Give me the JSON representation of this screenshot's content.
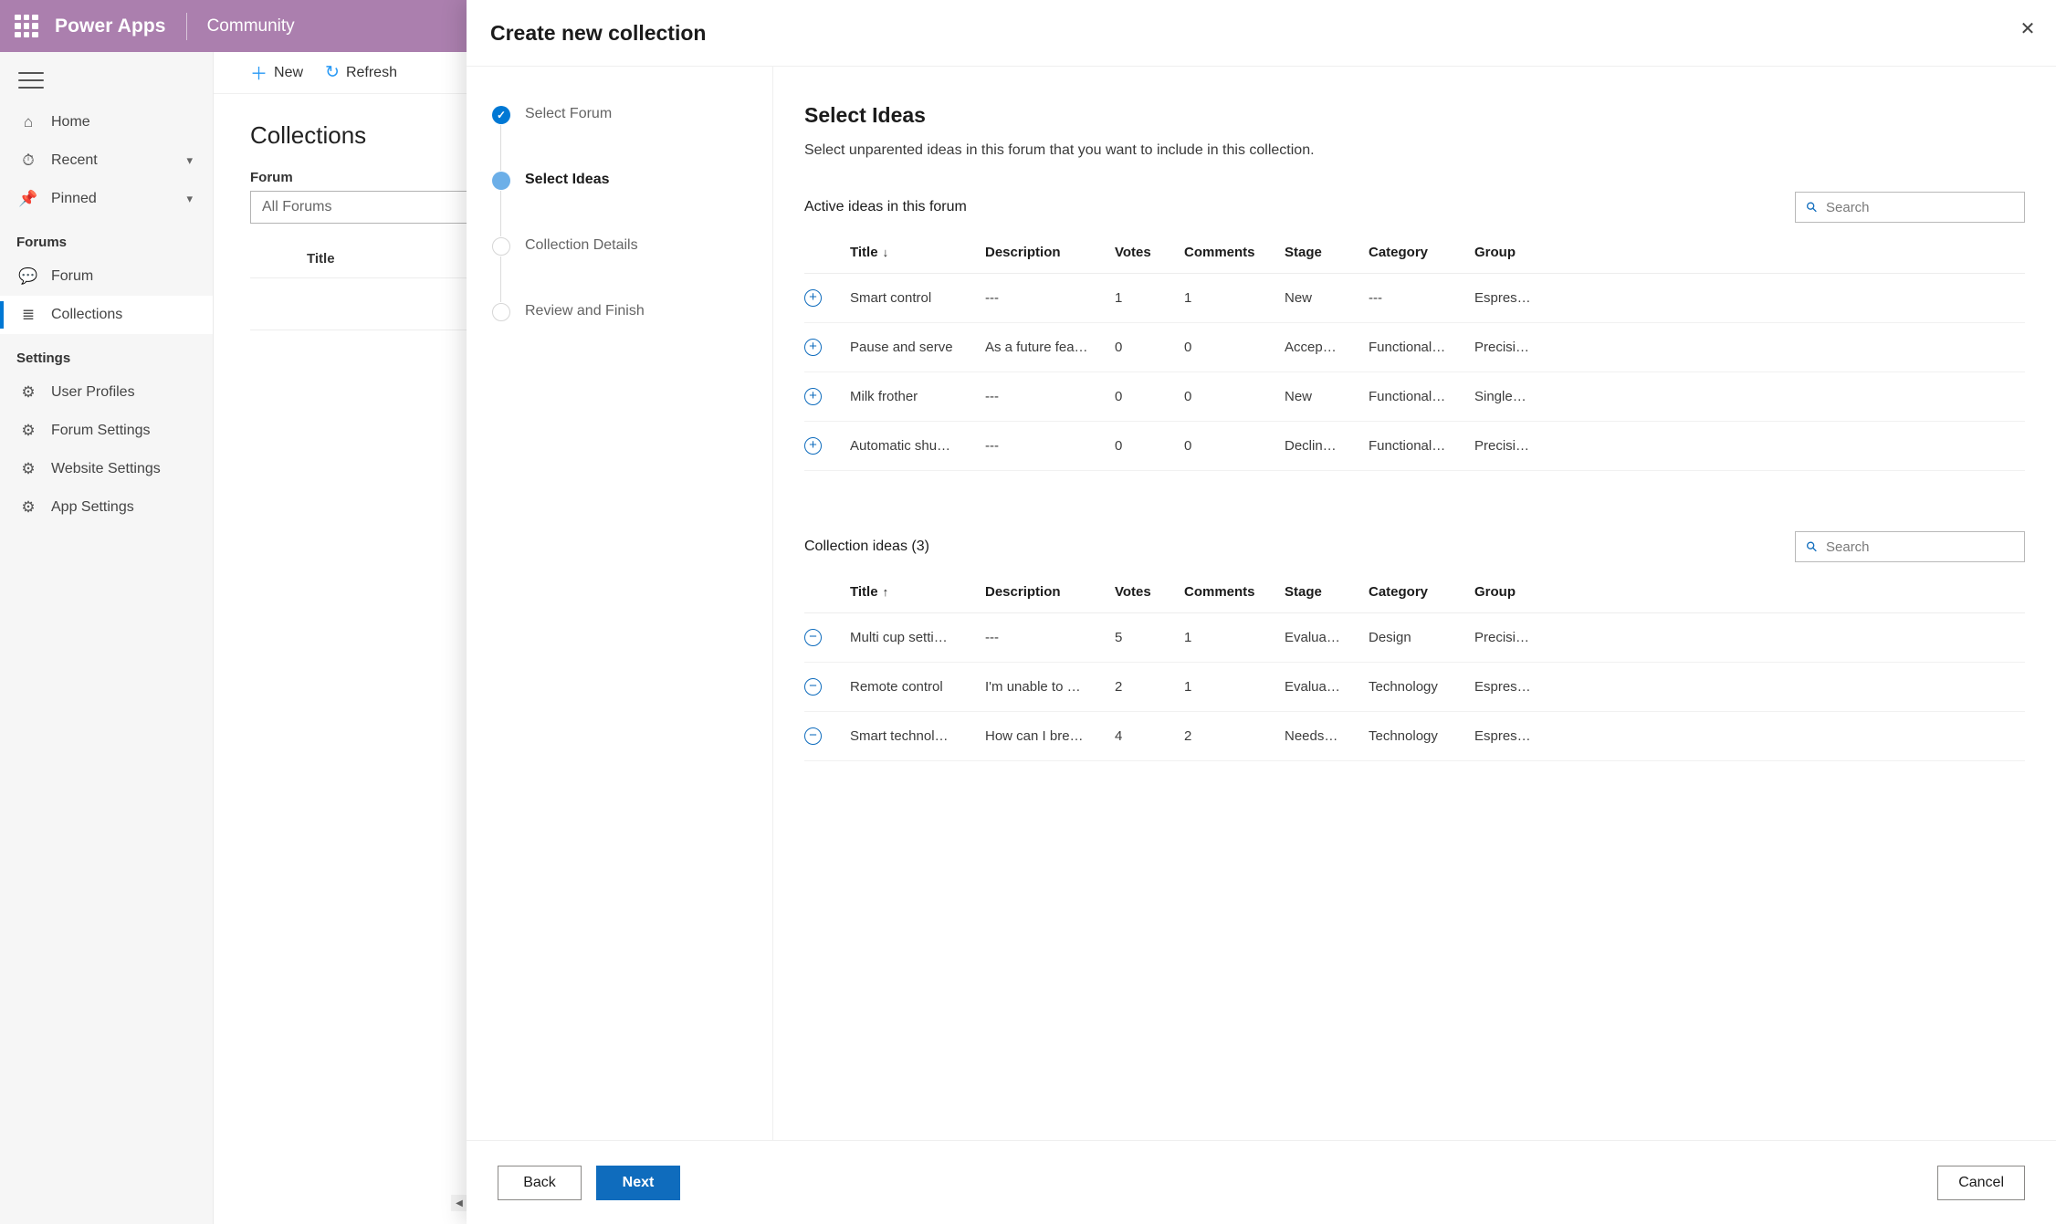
{
  "topbar": {
    "waffle_icon": "app-launcher-icon",
    "brand": "Power Apps",
    "sub_brand": "Community"
  },
  "sidebar": {
    "menu_icon": "hamburger-icon",
    "items": [
      {
        "label": "Home",
        "icon": "home-icon",
        "glyph": "⌂",
        "chevron": "",
        "selected": false
      },
      {
        "label": "Recent",
        "icon": "clock-icon",
        "glyph": "◴",
        "chevron": "⌄",
        "selected": false
      },
      {
        "label": "Pinned",
        "icon": "pin-icon",
        "glyph": "✐",
        "chevron": "⌄",
        "selected": false
      }
    ],
    "groups": [
      {
        "title": "Forums",
        "items": [
          {
            "label": "Forum",
            "icon": "forum-icon",
            "glyph": "⌸",
            "selected": false
          },
          {
            "label": "Collections",
            "icon": "collections-icon",
            "glyph": "≡",
            "selected": true
          }
        ]
      },
      {
        "title": "Settings",
        "items": [
          {
            "label": "User Profiles",
            "icon": "gear-icon",
            "glyph": "⚙",
            "selected": false
          },
          {
            "label": "Forum Settings",
            "icon": "gear-icon",
            "glyph": "⚙",
            "selected": false
          },
          {
            "label": "Website Settings",
            "icon": "gear-icon",
            "glyph": "⚙",
            "selected": false
          },
          {
            "label": "App Settings",
            "icon": "gear-icon",
            "glyph": "⚙",
            "selected": false
          }
        ]
      }
    ]
  },
  "background_page": {
    "commands": [
      {
        "label": "New",
        "icon": "plus-icon",
        "glyph": "＋"
      },
      {
        "label": "Refresh",
        "icon": "refresh-icon",
        "glyph": "↻"
      }
    ],
    "title": "Collections",
    "forum_field_label": "Forum",
    "forum_value": "All Forums",
    "table_header_title": "Title",
    "scrollbar_arrow": "◀"
  },
  "dialog": {
    "title": "Create new collection",
    "close_icon": "close-icon",
    "close_glyph": "✕",
    "steps": [
      {
        "label": "Select Forum",
        "state": "done"
      },
      {
        "label": "Select Ideas",
        "state": "current"
      },
      {
        "label": "Collection Details",
        "state": "todo"
      },
      {
        "label": "Review and Finish",
        "state": "todo"
      }
    ],
    "panel": {
      "heading": "Select Ideas",
      "subtitle": "Select unparented ideas in this forum that you want to include in this collection.",
      "sections": [
        {
          "title": "Active ideas in this forum",
          "search_placeholder": "Search",
          "search_value": "",
          "sort_column": "Title",
          "sort_direction": "↓",
          "action_glyph": "+",
          "action_name": "add-idea-button",
          "columns": [
            "Title",
            "Description",
            "Votes",
            "Comments",
            "Stage",
            "Category",
            "Group"
          ],
          "rows": [
            {
              "title": "Smart control",
              "description": "---",
              "votes": "1",
              "comments": "1",
              "stage": "New",
              "category": "---",
              "group": "Espres…"
            },
            {
              "title": "Pause and serve",
              "description": "As a future fea…",
              "votes": "0",
              "comments": "0",
              "stage": "Accep…",
              "category": "Functional…",
              "group": "Precisi…"
            },
            {
              "title": "Milk frother",
              "description": "---",
              "votes": "0",
              "comments": "0",
              "stage": "New",
              "category": "Functional…",
              "group": "Single…"
            },
            {
              "title": "Automatic shu…",
              "description": "---",
              "votes": "0",
              "comments": "0",
              "stage": "Declin…",
              "category": "Functional…",
              "group": "Precisi…"
            }
          ]
        },
        {
          "title": "Collection ideas (3)",
          "search_placeholder": "Search",
          "search_value": "",
          "sort_column": "Title",
          "sort_direction": "↑",
          "action_glyph": "−",
          "action_name": "remove-idea-button",
          "columns": [
            "Title",
            "Description",
            "Votes",
            "Comments",
            "Stage",
            "Category",
            "Group"
          ],
          "rows": [
            {
              "title": "Multi cup setti…",
              "description": "---",
              "votes": "5",
              "comments": "1",
              "stage": "Evalua…",
              "category": "Design",
              "group": "Precisi…"
            },
            {
              "title": "Remote control",
              "description": "I'm unable to …",
              "votes": "2",
              "comments": "1",
              "stage": "Evalua…",
              "category": "Technology",
              "group": "Espres…"
            },
            {
              "title": "Smart technol…",
              "description": "How can I bre…",
              "votes": "4",
              "comments": "2",
              "stage": "Needs…",
              "category": "Technology",
              "group": "Espres…"
            }
          ]
        }
      ]
    },
    "footer": {
      "back_label": "Back",
      "next_label": "Next",
      "cancel_label": "Cancel"
    }
  },
  "colors": {
    "brand_purple": "#ab7fae",
    "accent_blue": "#0f6cbd",
    "step_current": "#6cafe8",
    "step_done": "#0078d4"
  }
}
